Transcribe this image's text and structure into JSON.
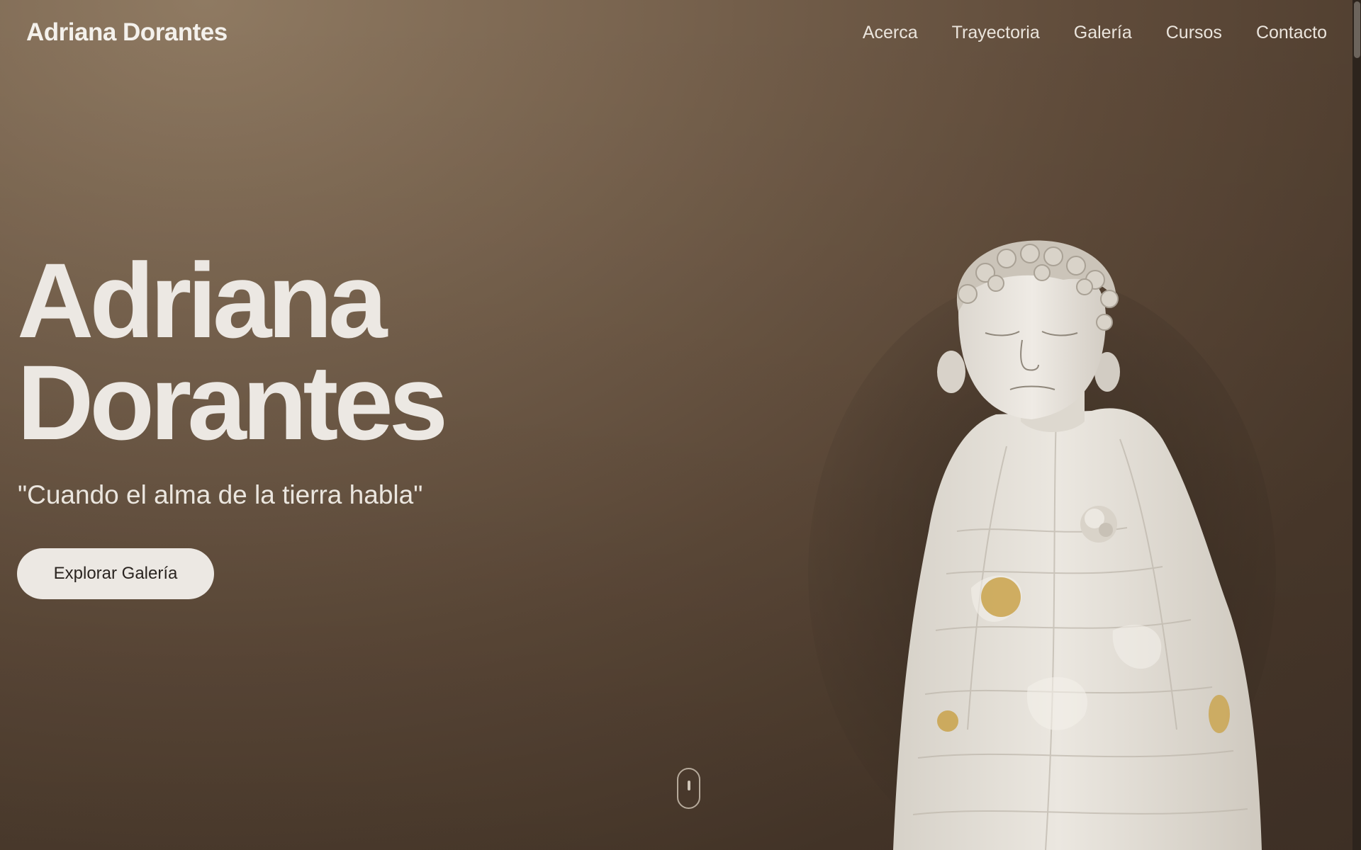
{
  "header": {
    "brand": "Adriana Dorantes",
    "nav": [
      {
        "label": "Acerca"
      },
      {
        "label": "Trayectoria"
      },
      {
        "label": "Galería"
      },
      {
        "label": "Cursos"
      },
      {
        "label": "Contacto"
      }
    ]
  },
  "hero": {
    "title_line1": "Adriana",
    "title_line2": "Dorantes",
    "tagline": "\"Cuando el alma de la tierra habla\"",
    "cta_label": "Explorar Galería"
  },
  "sculpture": {
    "description_icon": "ceramic-sculpture-figure"
  },
  "scroll": {
    "icon": "mouse-scroll-icon"
  },
  "colors": {
    "background_top": "#8f7a62",
    "background_bottom": "#45352a",
    "text_light": "#ece8e3",
    "button_bg": "#ece8e3",
    "sculpture_clay": "#e6e2da",
    "gold_accent": "#c9a24a"
  }
}
